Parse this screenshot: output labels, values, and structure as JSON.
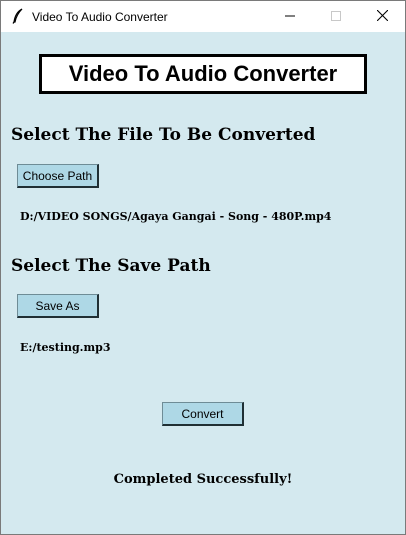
{
  "window": {
    "title": "Video To Audio Converter",
    "icon": "feather-icon",
    "controls": [
      "minimize-icon",
      "maximize-icon",
      "close-icon"
    ]
  },
  "app": {
    "heading": "Video To Audio Converter",
    "source_section": {
      "title": "Select The File To Be Converted",
      "button_label": "Choose Path",
      "selected_path": "D:/VIDEO SONGS/Agaya Gangai - Song - 480P.mp4"
    },
    "save_section": {
      "title": "Select The Save Path",
      "button_label": "Save As",
      "selected_path": "E:/testing.mp3"
    },
    "convert_button_label": "Convert",
    "status_message": "Completed Successfully!"
  },
  "colors": {
    "background": "#d4e9ef",
    "button": "#aed8e6"
  }
}
